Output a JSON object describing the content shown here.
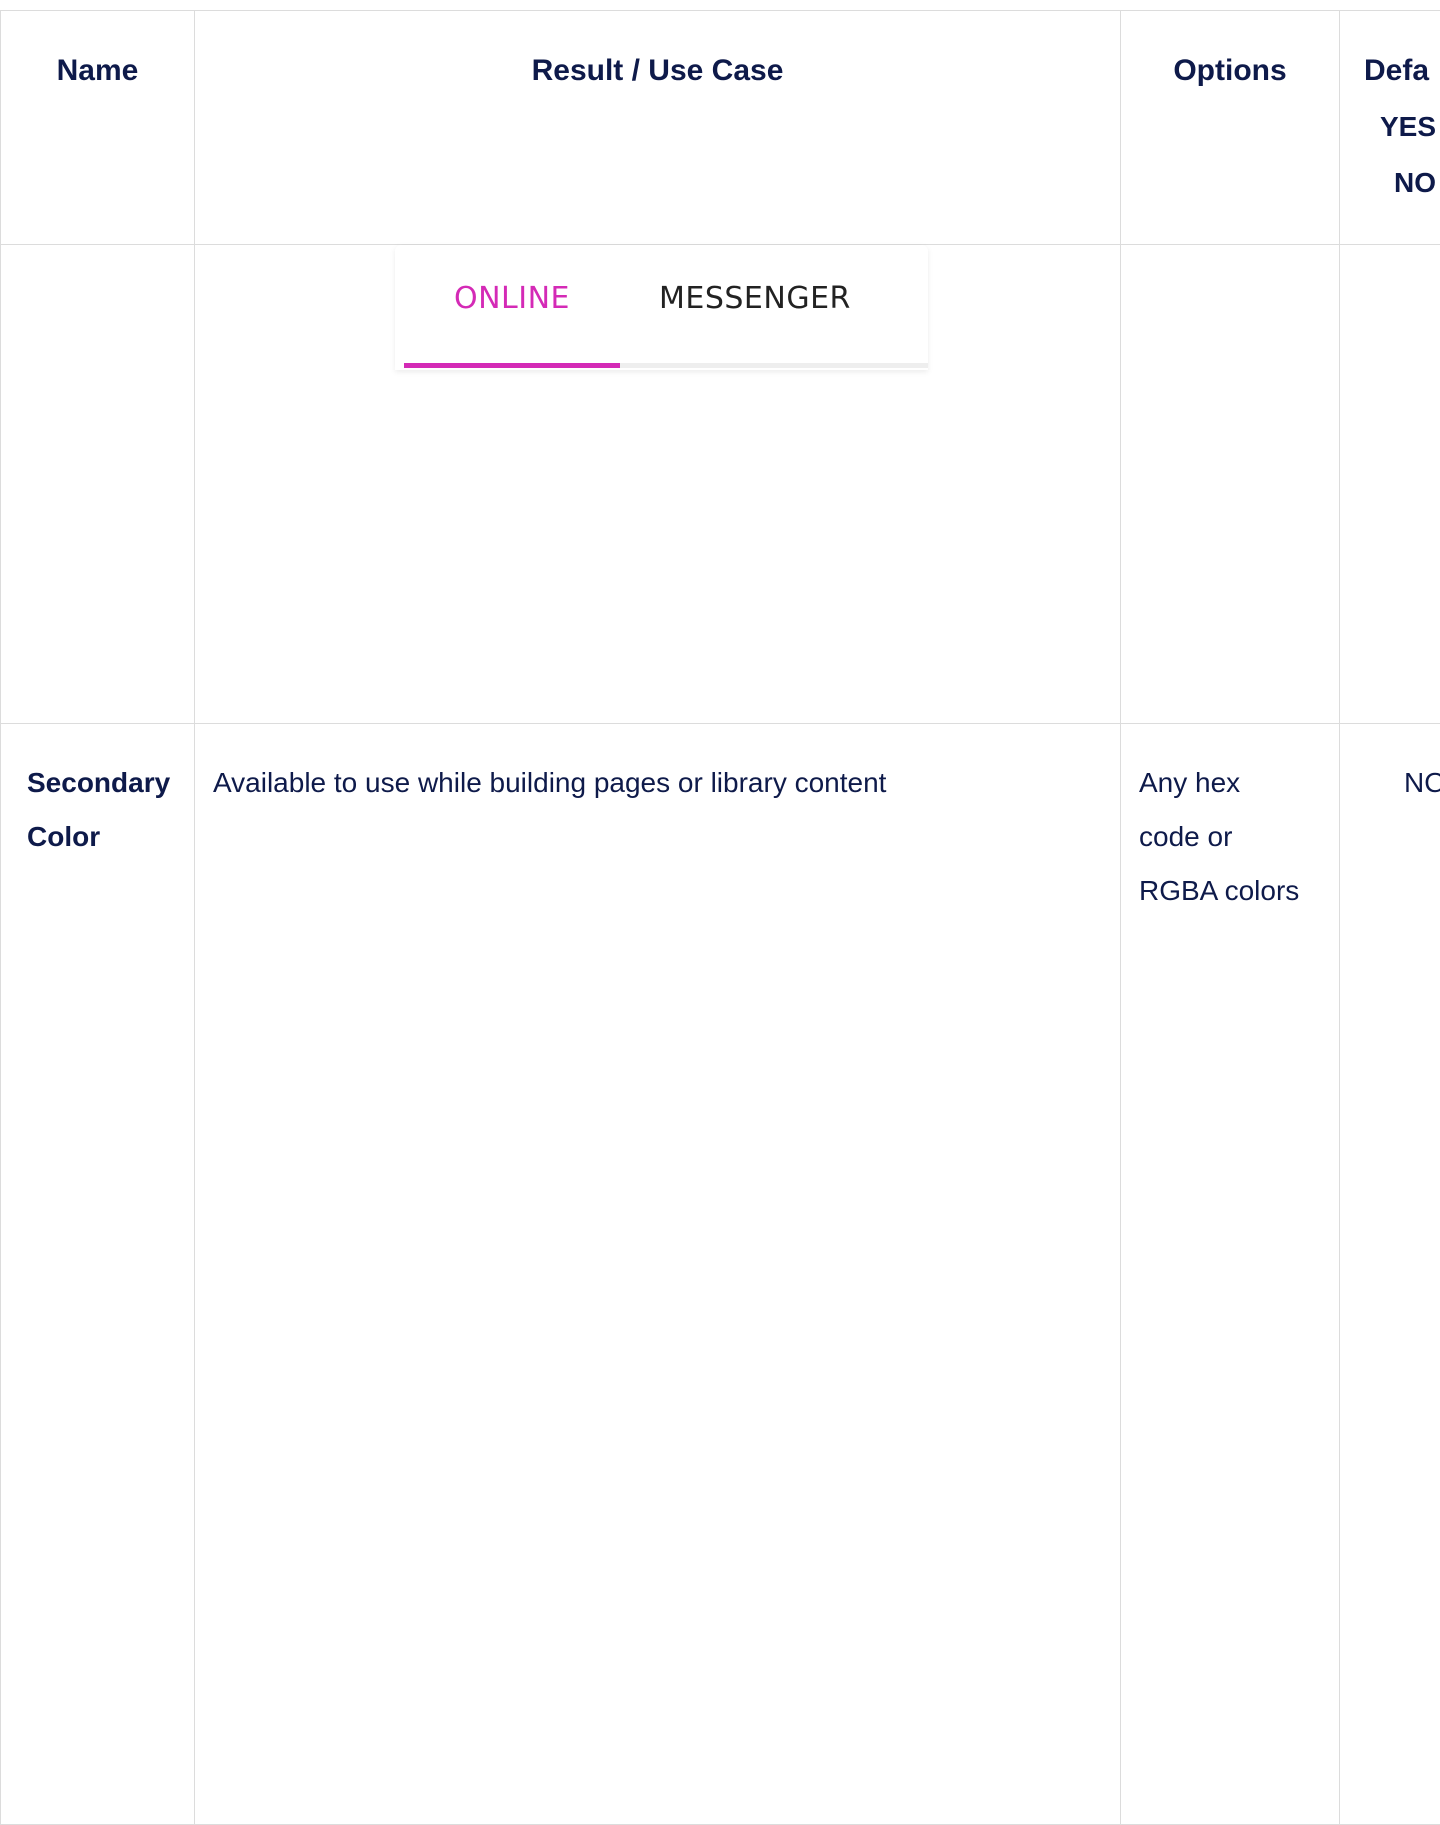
{
  "table": {
    "headers": {
      "name": "Name",
      "result": "Result / Use Case",
      "options": "Options",
      "default": "Defa",
      "default_yes": "YES",
      "default_no": "NO"
    },
    "rows": [
      {
        "name": "",
        "preview": {
          "tabs": [
            "ONLINE",
            "MESSENGER"
          ],
          "active_tab": "ONLINE",
          "active_color": "#d42ab6"
        },
        "options": "",
        "default": ""
      },
      {
        "name_line1": "Secondary",
        "name_line2": "Color",
        "result": "Available to use while building pages or library content",
        "options_line1": "Any hex",
        "options_line2": "code or",
        "options_line3": "RGBA colors",
        "default": "NO"
      }
    ]
  }
}
